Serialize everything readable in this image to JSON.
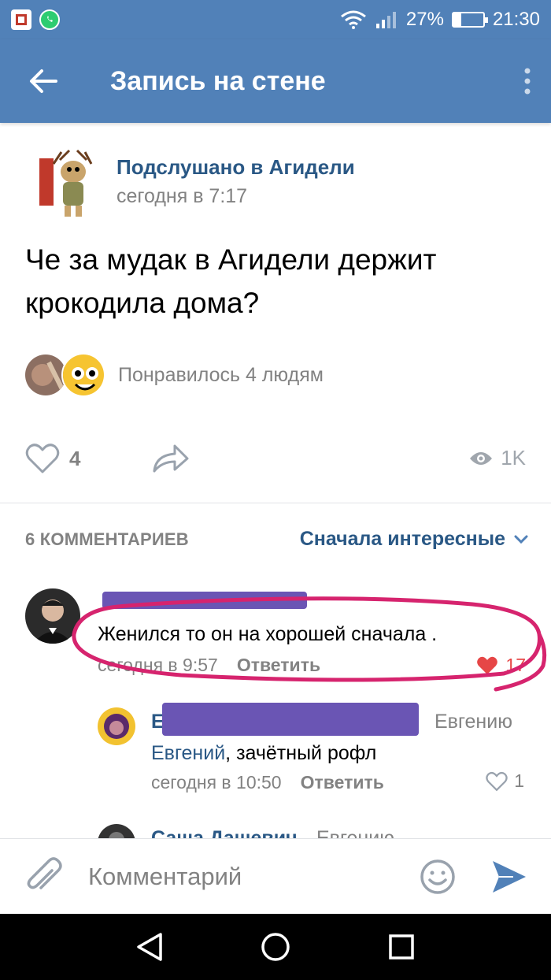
{
  "status_bar": {
    "battery": "27%",
    "battery_level": 0.27,
    "time": "21:30",
    "icons": [
      "app-notification-icon",
      "whatsapp-icon",
      "wifi-icon",
      "signal-icon",
      "battery-icon"
    ]
  },
  "app_bar": {
    "title": "Запись на стене",
    "back_icon": "back-arrow-icon",
    "menu_icon": "more-vert-icon"
  },
  "post": {
    "group_name": "Подслушано в Агидели",
    "time": "сегодня в 7:17",
    "text": "Че за мудак в Агидели держит крокодила дома?",
    "likers_text": "Понравилось 4 людям",
    "like_count": "4",
    "views": "1K"
  },
  "comments_section": {
    "count_label": "6 КОММЕНТАРИЕВ",
    "sort_label": "Сначала интересные"
  },
  "comments": [
    {
      "text": "Женился то он на хорошей сначала .",
      "time": "сегодня в 9:57",
      "reply_label": "Ответить",
      "likes": "17",
      "liked": true
    },
    {
      "author_visible": "Е",
      "reply_to": "Евгению",
      "mention": "Евгений",
      "text": ", зачётный рофл",
      "time": "сегодня в 10:50",
      "reply_label": "Ответить",
      "likes": "1"
    },
    {
      "author": "Саша Дашевич",
      "reply_to": "Евгению"
    }
  ],
  "composer": {
    "placeholder": "Комментарий"
  },
  "colors": {
    "header_blue": "#5181b8",
    "link_blue": "#2a5885",
    "grey_text": "#828282",
    "annotation_pink": "#d6246e",
    "like_red": "#e64646"
  }
}
